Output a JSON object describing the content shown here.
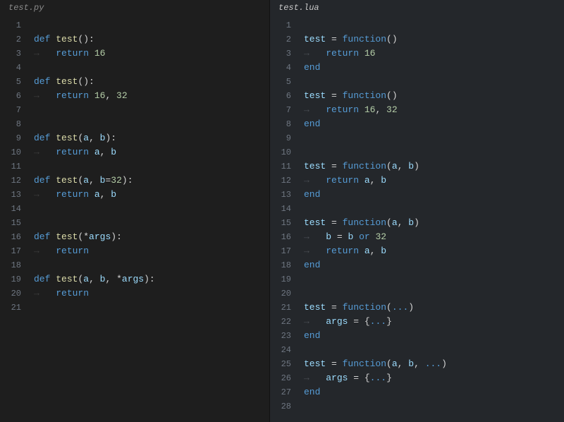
{
  "left": {
    "filename": "test.py",
    "lines": [
      {
        "n": 1,
        "tokens": []
      },
      {
        "n": 2,
        "tokens": [
          {
            "cls": "kw",
            "t": "def "
          },
          {
            "cls": "fn",
            "t": "test"
          },
          {
            "cls": "op",
            "t": "():"
          }
        ]
      },
      {
        "n": 3,
        "indent": true,
        "tokens": [
          {
            "cls": "kw",
            "t": "return "
          },
          {
            "cls": "num",
            "t": "16"
          }
        ]
      },
      {
        "n": 4,
        "tokens": []
      },
      {
        "n": 5,
        "tokens": [
          {
            "cls": "kw",
            "t": "def "
          },
          {
            "cls": "fn",
            "t": "test"
          },
          {
            "cls": "op",
            "t": "():"
          }
        ]
      },
      {
        "n": 6,
        "indent": true,
        "tokens": [
          {
            "cls": "kw",
            "t": "return "
          },
          {
            "cls": "num",
            "t": "16"
          },
          {
            "cls": "op",
            "t": ", "
          },
          {
            "cls": "num",
            "t": "32"
          }
        ]
      },
      {
        "n": 7,
        "tokens": []
      },
      {
        "n": 8,
        "tokens": []
      },
      {
        "n": 9,
        "tokens": [
          {
            "cls": "kw",
            "t": "def "
          },
          {
            "cls": "fn",
            "t": "test"
          },
          {
            "cls": "op",
            "t": "("
          },
          {
            "cls": "id",
            "t": "a"
          },
          {
            "cls": "op",
            "t": ", "
          },
          {
            "cls": "id",
            "t": "b"
          },
          {
            "cls": "op",
            "t": "):"
          }
        ]
      },
      {
        "n": 10,
        "indent": true,
        "tokens": [
          {
            "cls": "kw",
            "t": "return "
          },
          {
            "cls": "id",
            "t": "a"
          },
          {
            "cls": "op",
            "t": ", "
          },
          {
            "cls": "id",
            "t": "b"
          }
        ]
      },
      {
        "n": 11,
        "tokens": []
      },
      {
        "n": 12,
        "tokens": [
          {
            "cls": "kw",
            "t": "def "
          },
          {
            "cls": "fn",
            "t": "test"
          },
          {
            "cls": "op",
            "t": "("
          },
          {
            "cls": "id",
            "t": "a"
          },
          {
            "cls": "op",
            "t": ", "
          },
          {
            "cls": "id",
            "t": "b"
          },
          {
            "cls": "op",
            "t": "="
          },
          {
            "cls": "num",
            "t": "32"
          },
          {
            "cls": "op",
            "t": "):"
          }
        ]
      },
      {
        "n": 13,
        "indent": true,
        "tokens": [
          {
            "cls": "kw",
            "t": "return "
          },
          {
            "cls": "id",
            "t": "a"
          },
          {
            "cls": "op",
            "t": ", "
          },
          {
            "cls": "id",
            "t": "b"
          }
        ]
      },
      {
        "n": 14,
        "tokens": []
      },
      {
        "n": 15,
        "tokens": []
      },
      {
        "n": 16,
        "tokens": [
          {
            "cls": "kw",
            "t": "def "
          },
          {
            "cls": "fn",
            "t": "test"
          },
          {
            "cls": "op",
            "t": "(*"
          },
          {
            "cls": "id",
            "t": "args"
          },
          {
            "cls": "op",
            "t": "):"
          }
        ]
      },
      {
        "n": 17,
        "indent": true,
        "tokens": [
          {
            "cls": "kw",
            "t": "return"
          }
        ]
      },
      {
        "n": 18,
        "tokens": []
      },
      {
        "n": 19,
        "tokens": [
          {
            "cls": "kw",
            "t": "def "
          },
          {
            "cls": "fn",
            "t": "test"
          },
          {
            "cls": "op",
            "t": "("
          },
          {
            "cls": "id",
            "t": "a"
          },
          {
            "cls": "op",
            "t": ", "
          },
          {
            "cls": "id",
            "t": "b"
          },
          {
            "cls": "op",
            "t": ", *"
          },
          {
            "cls": "id",
            "t": "args"
          },
          {
            "cls": "op",
            "t": "):"
          }
        ]
      },
      {
        "n": 20,
        "indent": true,
        "tokens": [
          {
            "cls": "kw",
            "t": "return"
          }
        ]
      },
      {
        "n": 21,
        "tokens": []
      }
    ]
  },
  "right": {
    "filename": "test.lua",
    "lines": [
      {
        "n": 1,
        "tokens": []
      },
      {
        "n": 2,
        "tokens": [
          {
            "cls": "id",
            "t": "test"
          },
          {
            "cls": "op",
            "t": " = "
          },
          {
            "cls": "kw",
            "t": "function"
          },
          {
            "cls": "op",
            "t": "()"
          }
        ]
      },
      {
        "n": 3,
        "indent": true,
        "tokens": [
          {
            "cls": "kw",
            "t": "return "
          },
          {
            "cls": "num",
            "t": "16"
          }
        ]
      },
      {
        "n": 4,
        "tokens": [
          {
            "cls": "kw",
            "t": "end"
          }
        ]
      },
      {
        "n": 5,
        "tokens": []
      },
      {
        "n": 6,
        "tokens": [
          {
            "cls": "id",
            "t": "test"
          },
          {
            "cls": "op",
            "t": " = "
          },
          {
            "cls": "kw",
            "t": "function"
          },
          {
            "cls": "op",
            "t": "()"
          }
        ]
      },
      {
        "n": 7,
        "indent": true,
        "tokens": [
          {
            "cls": "kw",
            "t": "return "
          },
          {
            "cls": "num",
            "t": "16"
          },
          {
            "cls": "op",
            "t": ", "
          },
          {
            "cls": "num",
            "t": "32"
          }
        ]
      },
      {
        "n": 8,
        "tokens": [
          {
            "cls": "kw",
            "t": "end"
          }
        ]
      },
      {
        "n": 9,
        "tokens": []
      },
      {
        "n": 10,
        "tokens": []
      },
      {
        "n": 11,
        "tokens": [
          {
            "cls": "id",
            "t": "test"
          },
          {
            "cls": "op",
            "t": " = "
          },
          {
            "cls": "kw",
            "t": "function"
          },
          {
            "cls": "op",
            "t": "("
          },
          {
            "cls": "id",
            "t": "a"
          },
          {
            "cls": "op",
            "t": ", "
          },
          {
            "cls": "id",
            "t": "b"
          },
          {
            "cls": "op",
            "t": ")"
          }
        ]
      },
      {
        "n": 12,
        "indent": true,
        "tokens": [
          {
            "cls": "kw",
            "t": "return "
          },
          {
            "cls": "id",
            "t": "a"
          },
          {
            "cls": "op",
            "t": ", "
          },
          {
            "cls": "id",
            "t": "b"
          }
        ]
      },
      {
        "n": 13,
        "tokens": [
          {
            "cls": "kw",
            "t": "end"
          }
        ]
      },
      {
        "n": 14,
        "tokens": []
      },
      {
        "n": 15,
        "tokens": [
          {
            "cls": "id",
            "t": "test"
          },
          {
            "cls": "op",
            "t": " = "
          },
          {
            "cls": "kw",
            "t": "function"
          },
          {
            "cls": "op",
            "t": "("
          },
          {
            "cls": "id",
            "t": "a"
          },
          {
            "cls": "op",
            "t": ", "
          },
          {
            "cls": "id",
            "t": "b"
          },
          {
            "cls": "op",
            "t": ")"
          }
        ]
      },
      {
        "n": 16,
        "indent": true,
        "tokens": [
          {
            "cls": "id",
            "t": "b"
          },
          {
            "cls": "op",
            "t": " = "
          },
          {
            "cls": "id",
            "t": "b"
          },
          {
            "cls": "op",
            "t": " "
          },
          {
            "cls": "kw",
            "t": "or"
          },
          {
            "cls": "op",
            "t": " "
          },
          {
            "cls": "num",
            "t": "32"
          }
        ]
      },
      {
        "n": 17,
        "indent": true,
        "tokens": [
          {
            "cls": "kw",
            "t": "return "
          },
          {
            "cls": "id",
            "t": "a"
          },
          {
            "cls": "op",
            "t": ", "
          },
          {
            "cls": "id",
            "t": "b"
          }
        ]
      },
      {
        "n": 18,
        "tokens": [
          {
            "cls": "kw",
            "t": "end"
          }
        ]
      },
      {
        "n": 19,
        "tokens": []
      },
      {
        "n": 20,
        "tokens": []
      },
      {
        "n": 21,
        "tokens": [
          {
            "cls": "id",
            "t": "test"
          },
          {
            "cls": "op",
            "t": " = "
          },
          {
            "cls": "kw",
            "t": "function"
          },
          {
            "cls": "op",
            "t": "("
          },
          {
            "cls": "vararg",
            "t": "..."
          },
          {
            "cls": "op",
            "t": ")"
          }
        ]
      },
      {
        "n": 22,
        "indent": true,
        "tokens": [
          {
            "cls": "id",
            "t": "args"
          },
          {
            "cls": "op",
            "t": " = {"
          },
          {
            "cls": "vararg",
            "t": "..."
          },
          {
            "cls": "op",
            "t": "}"
          }
        ]
      },
      {
        "n": 23,
        "tokens": [
          {
            "cls": "kw",
            "t": "end"
          }
        ]
      },
      {
        "n": 24,
        "tokens": []
      },
      {
        "n": 25,
        "tokens": [
          {
            "cls": "id",
            "t": "test"
          },
          {
            "cls": "op",
            "t": " = "
          },
          {
            "cls": "kw",
            "t": "function"
          },
          {
            "cls": "op",
            "t": "("
          },
          {
            "cls": "id",
            "t": "a"
          },
          {
            "cls": "op",
            "t": ", "
          },
          {
            "cls": "id",
            "t": "b"
          },
          {
            "cls": "op",
            "t": ", "
          },
          {
            "cls": "vararg",
            "t": "..."
          },
          {
            "cls": "op",
            "t": ")"
          }
        ]
      },
      {
        "n": 26,
        "indent": true,
        "tokens": [
          {
            "cls": "id",
            "t": "args"
          },
          {
            "cls": "op",
            "t": " = {"
          },
          {
            "cls": "vararg",
            "t": "..."
          },
          {
            "cls": "op",
            "t": "}"
          }
        ]
      },
      {
        "n": 27,
        "tokens": [
          {
            "cls": "kw",
            "t": "end"
          }
        ]
      },
      {
        "n": 28,
        "tokens": []
      }
    ]
  },
  "indent_glyph": "→   "
}
